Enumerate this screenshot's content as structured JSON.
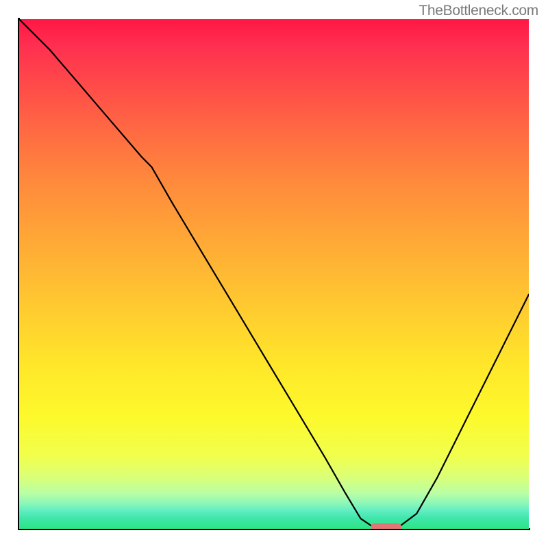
{
  "attribution": "TheBottleneck.com",
  "chart_data": {
    "type": "line",
    "title": "",
    "xlabel": "",
    "ylabel": "",
    "xlim": [
      0,
      100
    ],
    "ylim": [
      0,
      100
    ],
    "grid": false,
    "legend": false,
    "background": {
      "style": "vertical-gradient",
      "description": "red (top, high bottleneck) through orange and yellow to green (bottom, balanced)",
      "stops": [
        {
          "pos": 0,
          "color": "#ff1744"
        },
        {
          "pos": 50,
          "color": "#ffaa36"
        },
        {
          "pos": 80,
          "color": "#fdf92c"
        },
        {
          "pos": 100,
          "color": "#2de583"
        }
      ]
    },
    "series": [
      {
        "name": "bottleneck-curve",
        "x": [
          0,
          6,
          12,
          18,
          24,
          26,
          30,
          36,
          42,
          48,
          54,
          60,
          64,
          67,
          70,
          74,
          78,
          82,
          88,
          94,
          100
        ],
        "y": [
          100,
          94,
          87,
          80,
          73,
          71,
          64,
          54,
          44,
          34,
          24,
          14,
          7,
          2,
          0,
          0,
          3,
          10,
          22,
          34,
          46
        ]
      }
    ],
    "marker": {
      "name": "optimum-marker",
      "shape": "rounded-bar",
      "x_range": [
        69,
        75
      ],
      "y": 0,
      "color": "#e27676"
    }
  }
}
